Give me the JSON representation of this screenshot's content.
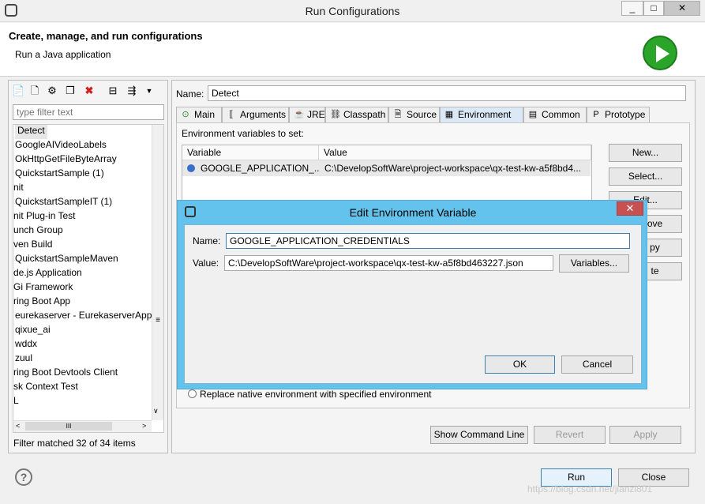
{
  "window": {
    "title": "Run Configurations",
    "controls": [
      "_",
      "□",
      "✕"
    ]
  },
  "header": {
    "title": "Create, manage, and run configurations",
    "subtitle": "Run a Java application"
  },
  "left": {
    "filter_placeholder": "type filter text",
    "items": [
      "Detect",
      "GoogleAIVideoLabels",
      "OkHttpGetFileByteArray",
      "QuickstartSample (1)",
      "nit",
      "QuickstartSampleIT (1)",
      "nit Plug-in Test",
      "unch Group",
      "ven Build",
      "QuickstartSampleMaven",
      "de.js Application",
      "Gi Framework",
      "ring Boot App",
      "eurekaserver - EurekaserverApplic",
      "qixue_ai",
      "wddx",
      "zuul",
      "ring Boot Devtools Client",
      "sk Context Test",
      "L"
    ],
    "filter_status": "Filter matched 32 of 34 items",
    "scroll_grip": "≡",
    "hscroll_thumb": "III"
  },
  "right": {
    "name_label": "Name:",
    "name_value": "Detect",
    "tabs": [
      "Main",
      "Arguments",
      "JRE",
      "Classpath",
      "Source",
      "Environment",
      "Common",
      "Prototype"
    ],
    "env_label": "Environment variables to set:",
    "columns": [
      "Variable",
      "Value"
    ],
    "rows": [
      {
        "variable": "GOOGLE_APPLICATION_...",
        "value": "C:\\DevelopSoftWare\\project-workspace\\qx-test-kw-a5f8bd4..."
      }
    ],
    "side_buttons": [
      "New...",
      "Select...",
      "Edit...",
      "Remove",
      "Copy",
      "Paste"
    ],
    "side_buttons_visible": [
      "New...",
      "Select...",
      "Edit...",
      "ove",
      "py",
      "te"
    ],
    "replace_label": "Replace native environment with specified environment",
    "show_cmd": "Show Command Line",
    "revert": "Revert",
    "apply": "Apply"
  },
  "footer": {
    "run": "Run",
    "close": "Close",
    "watermark": "https://blog.csdn.net/jianzi801"
  },
  "dialog": {
    "title": "Edit Environment Variable",
    "name_label": "Name:",
    "name_value": "GOOGLE_APPLICATION_CREDENTIALS",
    "value_label": "Value:",
    "value_value": "C:\\DevelopSoftWare\\project-workspace\\qx-test-kw-a5f8bd463227.json",
    "variables_button": "Variables...",
    "ok": "OK",
    "cancel": "Cancel",
    "close": "✕"
  },
  "colors": {
    "dialog_titlebar": "#64c3ec",
    "run_icon": "#2aa52a",
    "close_btn": "#c75050"
  }
}
